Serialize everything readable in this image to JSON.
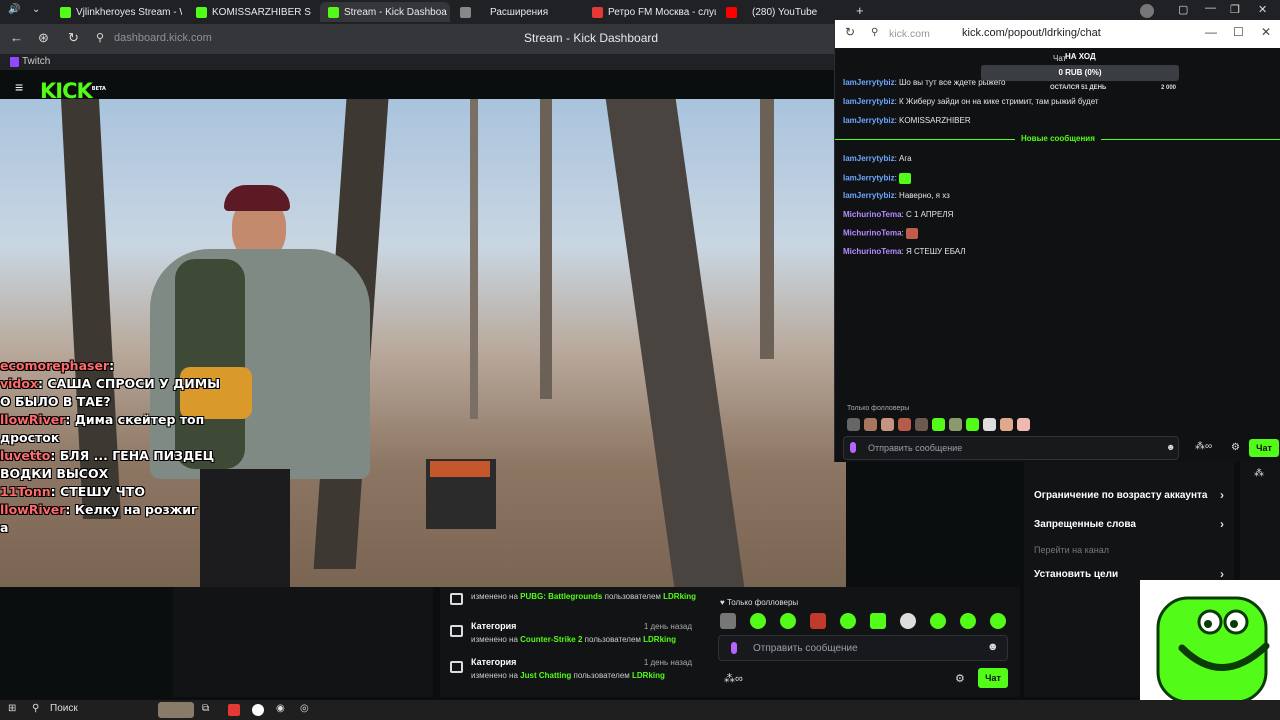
{
  "browser": {
    "tabs": [
      {
        "label": "Vjlinkheroyes Stream - Wa",
        "icon_color": "#53fc18"
      },
      {
        "label": "KOMISSARZHIBER S",
        "icon_color": "#53fc18"
      },
      {
        "label": "Stream - Kick Dashboa",
        "icon_color": "#53fc18"
      },
      {
        "label": "Расширения",
        "icon_color": "#888888"
      },
      {
        "label": "Ретро FM Москва - слуша",
        "icon_color": "#e53935"
      },
      {
        "label": "(280) YouTube",
        "icon_color": "#ff0000"
      }
    ],
    "url": "dashboard.kick.com",
    "page_title": "Stream - Kick Dashboard",
    "bookmark": "Twitch"
  },
  "kick": {
    "logo": "KICK",
    "logo_badge": "BETA"
  },
  "video_overlay_chat": [
    {
      "nick": "ecomorephaser",
      "text": ""
    },
    {
      "nick": "vidox",
      "text": "САША СПРОСИ У ДИМЫ"
    },
    {
      "nick": "",
      "text": "О БЫЛО В ТАЕ?"
    },
    {
      "nick": "llowRiver",
      "text": "Дима скейтер топ"
    },
    {
      "nick": "",
      "text": "дросток"
    },
    {
      "nick": "luvetto",
      "text": "БЛЯ ... ГЕНА ПИЗДЕЦ"
    },
    {
      "nick": "",
      "text": "ВОДКИ ВЫСОХ"
    },
    {
      "nick": "11Tonn",
      "text": "СТЕШУ ЧТО"
    },
    {
      "nick": "llowRiver",
      "text": "Келку на розжиг"
    },
    {
      "nick": "",
      "text": "а"
    }
  ],
  "popout": {
    "url_host": "kick.com",
    "url_path": "kick.com/popout/ldrking/chat",
    "chat_label": "Чат",
    "goal": {
      "title": "НА ХОД",
      "amount": "0 RUB (0%)",
      "remaining": "ОСТАЛСЯ 51 ДЕНЬ",
      "target": "2 000"
    },
    "messages": [
      {
        "nick": "IamJerrytybiz",
        "text": "Шо вы тут все ждете рыжего",
        "color": "n1"
      },
      {
        "nick": "IamJerrytybiz",
        "text": "К Жиберу зайди он на кике стримит, там рыжий будет",
        "color": "n1"
      },
      {
        "nick": "IamJerrytybiz",
        "text": "KOMISSARZHIBER",
        "color": "n1"
      }
    ],
    "new_messages_label": "Новые сообщения",
    "new_messages": [
      {
        "nick": "IamJerrytybiz",
        "text": "Ага",
        "color": "n1"
      },
      {
        "nick": "IamJerrytybiz",
        "text": "",
        "color": "n1",
        "emote": true
      },
      {
        "nick": "IamJerrytybiz",
        "text": "Наверно, я хз",
        "color": "n1"
      },
      {
        "nick": "MichurinoTema",
        "text": "С 1 АПРЕЛЯ",
        "color": "n2"
      },
      {
        "nick": "MichurinoTema",
        "text": "",
        "color": "n2",
        "emote": true
      },
      {
        "nick": "MichurinoTema",
        "text": "Я СТЕШУ ЕБАЛ",
        "color": "n2"
      }
    ],
    "followers_only": "Только фолловеры",
    "input_placeholder": "Отправить сообщение",
    "send_label": "Чат"
  },
  "activity": [
    {
      "title": "",
      "ago": "",
      "prefix": "изменено на",
      "category": "PUBG: Battlegrounds",
      "by": "пользователем",
      "user": "LDRking"
    },
    {
      "title": "Категория",
      "ago": "1 день назад",
      "prefix": "изменено на",
      "category": "Counter-Strike 2",
      "by": "пользователем",
      "user": "LDRking"
    },
    {
      "title": "Категория",
      "ago": "1 день назад",
      "prefix": "изменено на",
      "category": "Just Chatting",
      "by": "пользователем",
      "user": "LDRking"
    }
  ],
  "dashboard_chat": {
    "followers_only": "Только фолловеры",
    "input_placeholder": "Отправить сообщение",
    "send_label": "Чат"
  },
  "menu": [
    {
      "label": "Ограничение по возрасту аккаунта",
      "enabled": true
    },
    {
      "label": "Запрещенные слова",
      "enabled": true
    },
    {
      "label": "Перейти на канал",
      "enabled": false
    },
    {
      "label": "Установить цели",
      "enabled": true
    }
  ],
  "taskbar": {
    "search_label": "Поиск"
  },
  "colors": {
    "brand": "#53fc18",
    "nick_blue": "#6ea8ff",
    "nick_purple": "#b48cff"
  }
}
